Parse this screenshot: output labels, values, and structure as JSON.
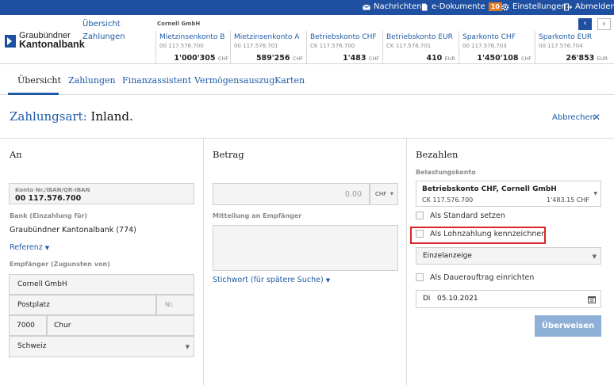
{
  "topbar": {
    "nachrichten": "Nachrichten",
    "edokumente": "e-Dokumente",
    "edokumente_count": "10",
    "einstellungen": "Einstellungen",
    "abmelden": "Abmelden"
  },
  "logo": {
    "line1": "Graubündner",
    "line2": "Kantonalbank"
  },
  "header_nav": {
    "uebersicht": "Übersicht",
    "zahlungen": "Zahlungen"
  },
  "account_group": "Cornell GmbH",
  "accounts": [
    {
      "name": "Mietzinsenkonto B",
      "number": "00 117.576.700",
      "balance": "1'000'305",
      "currency": "CHF"
    },
    {
      "name": "Mietzinsenkonto A",
      "number": "00 117.576.701",
      "balance": "589'256",
      "currency": "CHF"
    },
    {
      "name": "Betriebskonto CHF",
      "number": "CK 117.576.700",
      "balance": "1'483",
      "currency": "CHF"
    },
    {
      "name": "Betriebskonto EUR",
      "number": "CK 117.576.701",
      "balance": "410",
      "currency": "EUR"
    },
    {
      "name": "Sparkonto CHF",
      "number": "00 117.576.703",
      "balance": "1'450'108",
      "currency": "CHF"
    },
    {
      "name": "Sparkonto EUR",
      "number": "00 117.576.704",
      "balance": "26'853",
      "currency": "EUR"
    }
  ],
  "tabs": [
    "Übersicht",
    "Zahlungen",
    "Finanzassistent",
    "Vermögensauszug",
    "Karten"
  ],
  "title": {
    "part1": "Zahlungsart:",
    "part2": "Inland."
  },
  "abbrechen": "Abbrechen",
  "an": {
    "heading": "An",
    "konto_label": "Konto Nr./IBAN/QR-IBAN",
    "konto_value": "00 117.576.700",
    "bank_label": "Bank (Einzahlung für)",
    "bank_value": "Graubündner Kantonalbank (774)",
    "referenz": "Referenz",
    "empfaenger_label": "Empfänger (Zugunsten von)",
    "name": "Cornell GmbH",
    "street": "Postplatz",
    "nr_placeholder": "Nr.",
    "plz": "7000",
    "ort": "Chur",
    "land": "Schweiz"
  },
  "betrag": {
    "heading": "Betrag",
    "amount": "0.00",
    "currency": "CHF",
    "mitteilung_label": "Mitteilung an Empfänger",
    "stichwort": "Stichwort (für spätere Suche)"
  },
  "bezahlen": {
    "heading": "Bezahlen",
    "belastung_label": "Belastungskonto",
    "konto_name": "Betriebskonto CHF, Cornell GmbH",
    "konto_number": "CK 117.576.700",
    "konto_balance": "1'483.15 CHF",
    "standard": "Als Standard setzen",
    "lohnzahlung": "Als Lohnzahlung kennzeichnen",
    "anzeige": "Einzelanzeige",
    "dauerauftrag": "Als Dauerauftrag einrichten",
    "date": "Di   05.10.2021",
    "submit": "Überweisen"
  }
}
